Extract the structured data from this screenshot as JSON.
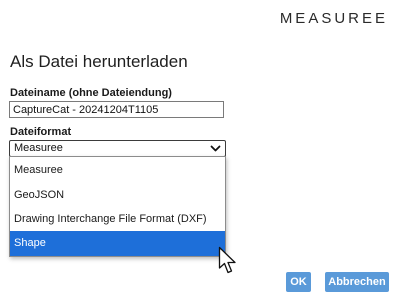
{
  "brand": {
    "logo_text": "MEASUREE"
  },
  "dialog": {
    "title": "Als Datei herunterladen",
    "filename": {
      "label": "Dateiname (ohne Dateiendung)",
      "value": "CaptureCat - 20241204T1105"
    },
    "format": {
      "label": "Dateiformat",
      "selected": "Measuree",
      "options": [
        "Measuree",
        "GeoJSON",
        "Drawing Interchange File Format (DXF)",
        "Shape"
      ],
      "highlighted": "Shape"
    },
    "buttons": {
      "ok": "OK",
      "cancel": "Abbrechen"
    }
  },
  "colors": {
    "accent": "#1e6fd9",
    "button": "#5a9ad9"
  },
  "icons": {
    "select_arrow": "chevron-down-icon",
    "cursor": "mouse-pointer-icon"
  }
}
